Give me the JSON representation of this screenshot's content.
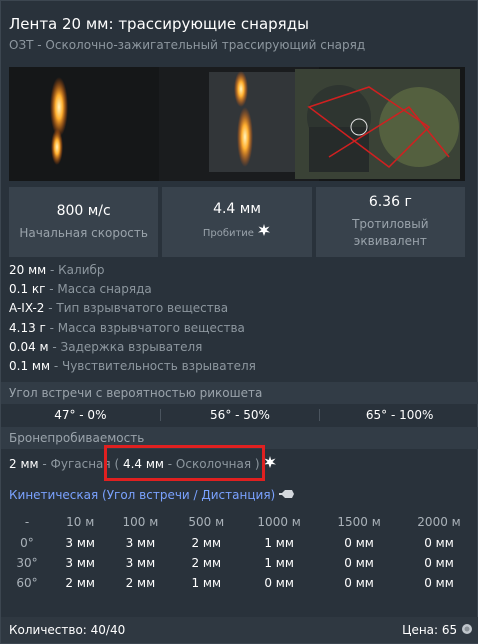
{
  "header": {
    "title": "Лента 20 мм: трассирующие снаряды",
    "subtitle": "ОЗТ - Осколочно-зажигательный трассирующий снаряд"
  },
  "stats": [
    {
      "value": "800 м/с",
      "label": "Начальная скорость"
    },
    {
      "value": "4.4 мм",
      "label": "Пробитие"
    },
    {
      "value": "6.36 г",
      "label": "Тротиловый эквивалент"
    }
  ],
  "properties": [
    {
      "value": "20 мм",
      "desc": " - Калибр"
    },
    {
      "value": "0.1 кг",
      "desc": " - Масса снаряда"
    },
    {
      "value": "A-IX-2",
      "desc": " - Тип взрывчатого вещества"
    },
    {
      "value": "4.13 г",
      "desc": " - Масса взрывчатого вещества"
    },
    {
      "value": "0.04 м",
      "desc": " - Задержка взрывателя"
    },
    {
      "value": "0.1 мм",
      "desc": " - Чувствительность взрывателя"
    }
  ],
  "ricochet": {
    "header": "Угол встречи с вероятностью рикошета",
    "values": [
      "47° - 0%",
      "56° - 50%",
      "65° - 100%"
    ]
  },
  "penetration": {
    "header": "Бронепробиваемость",
    "he_value": "2 мм",
    "he_label": " - Фугасная",
    "open_paren": " ( ",
    "frag_value": "4.4 мм",
    "frag_label": " - Осколочная",
    "close_paren": " )"
  },
  "kinetic": {
    "label": "Кинетическая (Угол встречи / Дистанция)",
    "columns": [
      "-",
      "10 м",
      "100 м",
      "500 м",
      "1000 м",
      "1500 м",
      "2000 м"
    ],
    "rows": [
      [
        "0°",
        "3 мм",
        "3 мм",
        "2 мм",
        "1 мм",
        "0 мм",
        "0 мм"
      ],
      [
        "30°",
        "3 мм",
        "3 мм",
        "2 мм",
        "1 мм",
        "0 мм",
        "0 мм"
      ],
      [
        "60°",
        "2 мм",
        "2 мм",
        "1 мм",
        "0 мм",
        "0 мм",
        "0 мм"
      ]
    ]
  },
  "footer": {
    "quantity": "Количество: 40/40",
    "price": "Цена: 65"
  },
  "colors": {
    "highlight": "#e02020",
    "kinetic_link": "#7aa2ff"
  },
  "icons": [
    "explosion-icon",
    "shell-icon",
    "silver-lions-icon"
  ]
}
